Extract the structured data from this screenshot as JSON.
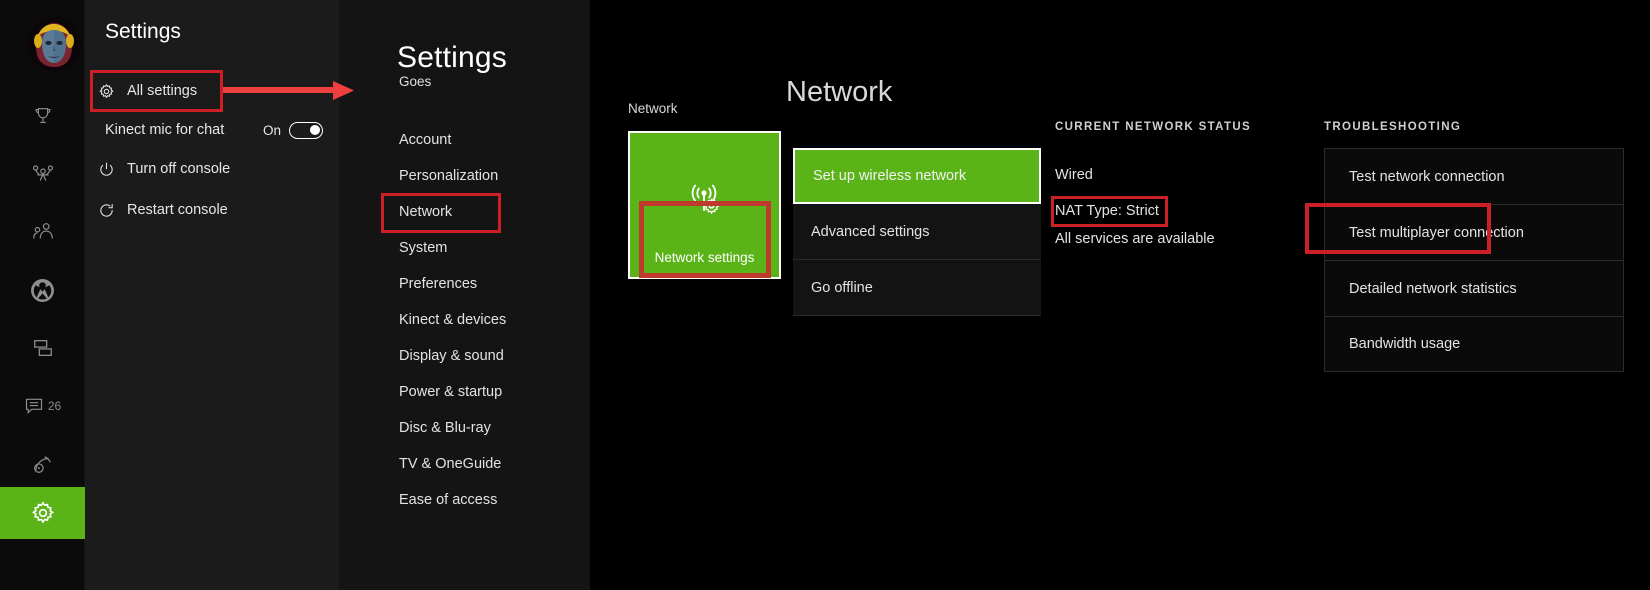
{
  "colors": {
    "xbox_green": "#5bb417",
    "annotation_red": "#cc2026",
    "arrow_red": "#ef4040",
    "panel_dark": "#1b1b1b",
    "background": "#000000"
  },
  "rail": {
    "avatar_name": "user-avatar",
    "items": [
      {
        "name": "achievements-trophy-icon",
        "badge": ""
      },
      {
        "name": "party-multiplayer-icon",
        "badge": ""
      },
      {
        "name": "friends-icon",
        "badge": ""
      },
      {
        "name": "xbox-logo-icon",
        "badge": ""
      },
      {
        "name": "multitask-snap-icon",
        "badge": ""
      },
      {
        "name": "messages-icon",
        "badge": "26"
      },
      {
        "name": "broadcast-capture-icon",
        "badge": ""
      },
      {
        "name": "settings-gear-icon",
        "badge": ""
      }
    ],
    "message_badge": "26"
  },
  "flyout": {
    "title": "Settings",
    "rows": [
      {
        "label": "All settings",
        "icon": "gear-icon",
        "has_icon": true
      },
      {
        "label": "Kinect mic for chat",
        "icon": "",
        "has_icon": false,
        "toggle_state": "On",
        "toggle_on": true
      },
      {
        "label": "Turn off console",
        "icon": "power-icon",
        "has_icon": true
      },
      {
        "label": "Restart console",
        "icon": "restart-icon",
        "has_icon": true
      }
    ]
  },
  "menu": {
    "title": "Settings",
    "subtitle": "Goes",
    "items": [
      "Account",
      "Personalization",
      "Network",
      "System",
      "Preferences",
      "Kinect & devices",
      "Display & sound",
      "Power & startup",
      "Disc & Blu-ray",
      "TV & OneGuide",
      "Ease of access"
    ],
    "highlighted_item": "Network"
  },
  "main": {
    "page_title": "Network",
    "column_label": "Network",
    "tile": {
      "label": "Network settings",
      "icon": "wireless-settings-icon"
    },
    "actions": [
      {
        "label": "Set up wireless network",
        "selected": true
      },
      {
        "label": "Advanced settings",
        "selected": false
      },
      {
        "label": "Go offline",
        "selected": false
      }
    ],
    "status": {
      "heading": "CURRENT NETWORK STATUS",
      "lines": [
        "Wired",
        "NAT Type: Strict",
        "All services are available"
      ],
      "highlighted_line": "NAT Type: Strict"
    },
    "troubleshooting": {
      "heading": "TROUBLESHOOTING",
      "items": [
        "Test network connection",
        "Test multiplayer connection",
        "Detailed network statistics",
        "Bandwidth usage"
      ],
      "highlighted_item": "Test multiplayer connection"
    }
  },
  "annotations": {
    "arrow_from": "All settings",
    "arrow_to": "Settings menu column",
    "boxes": [
      "All settings",
      "Network",
      "Network settings",
      "NAT Type: Strict",
      "Test multiplayer connection"
    ]
  }
}
